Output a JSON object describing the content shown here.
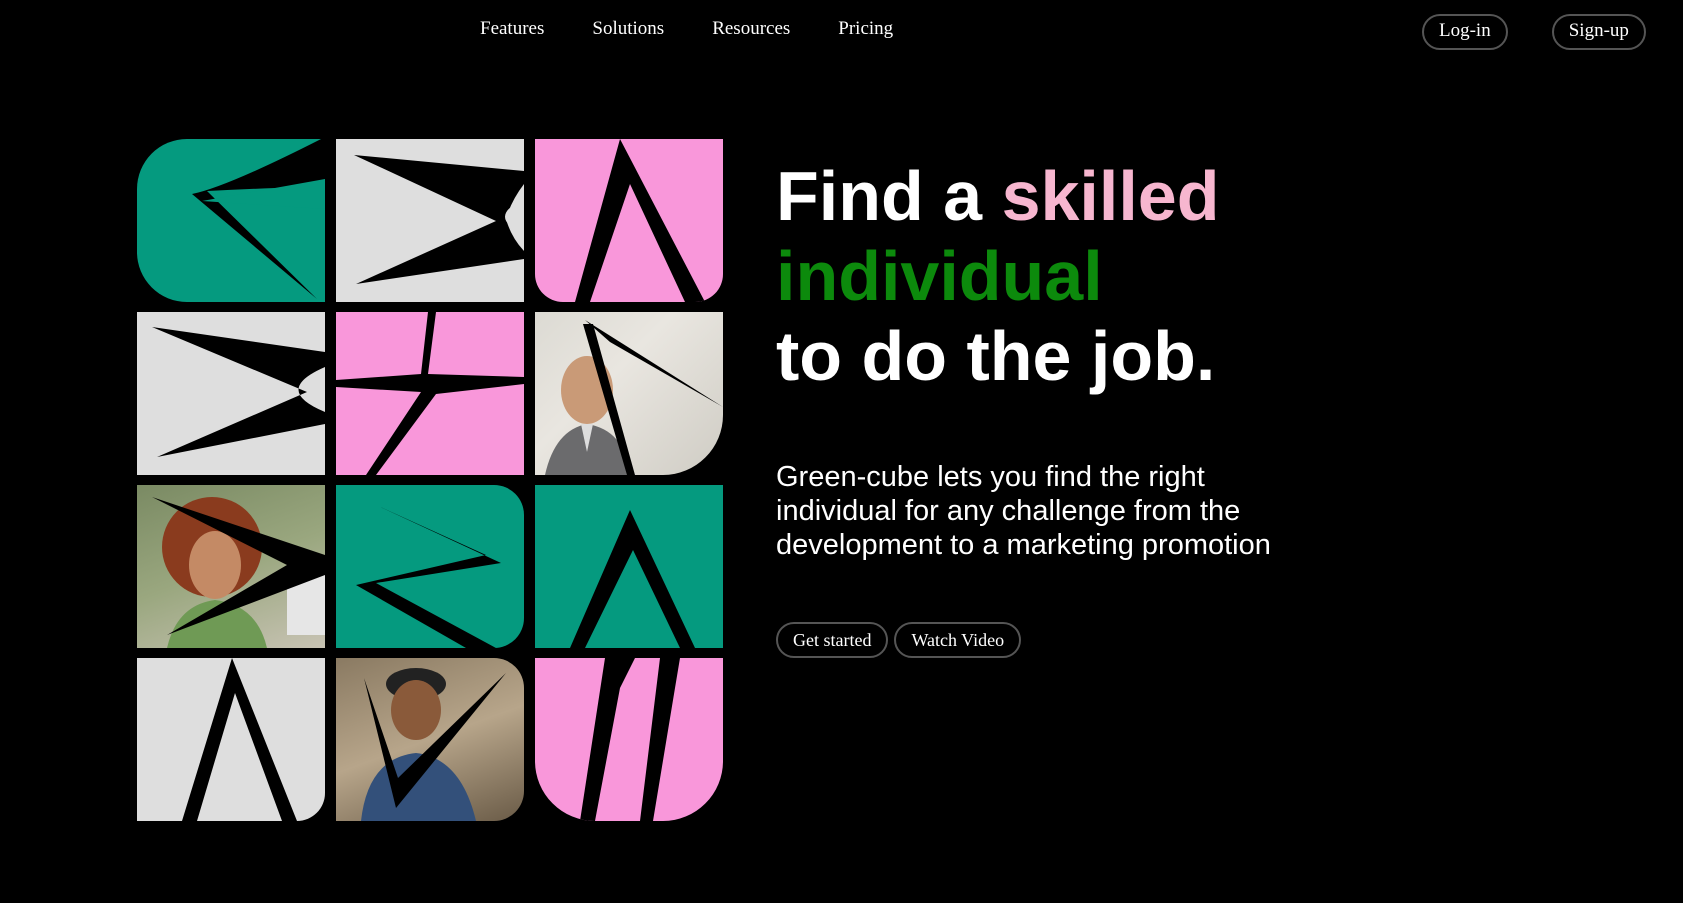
{
  "nav": {
    "links": [
      "Features",
      "Solutions",
      "Resources",
      "Pricing"
    ],
    "login_label": "Log-in",
    "signup_label": "Sign-up"
  },
  "hero": {
    "headline_part1": "Find a ",
    "headline_accent1": "skilled",
    "headline_accent2": "individual",
    "headline_part2": "to do the job.",
    "subtext": "Green-cube lets you find the right individual for any challenge from the development to a marketing promotion",
    "get_started_label": "Get started",
    "watch_video_label": "Watch Video"
  },
  "colors": {
    "background": "#000000",
    "green_tile": "#059a7f",
    "gray_tile": "#dedede",
    "pink_tile": "#f997da",
    "accent_pink": "#f7b6cf",
    "accent_green": "#0c8a0c"
  },
  "tiles": [
    {
      "color": "green",
      "content": "abstract-shape"
    },
    {
      "color": "gray",
      "content": "abstract-shape"
    },
    {
      "color": "pink",
      "content": "abstract-shape"
    },
    {
      "color": "gray",
      "content": "abstract-shape"
    },
    {
      "color": "pink",
      "content": "abstract-shape"
    },
    {
      "color": "photo",
      "content": "man-in-blazer-photo"
    },
    {
      "color": "photo",
      "content": "curly-haired-woman-photo"
    },
    {
      "color": "green",
      "content": "abstract-shape"
    },
    {
      "color": "green",
      "content": "abstract-shape"
    },
    {
      "color": "gray",
      "content": "abstract-shape"
    },
    {
      "color": "photo",
      "content": "man-with-beanie-photo"
    },
    {
      "color": "pink",
      "content": "abstract-shape"
    }
  ]
}
